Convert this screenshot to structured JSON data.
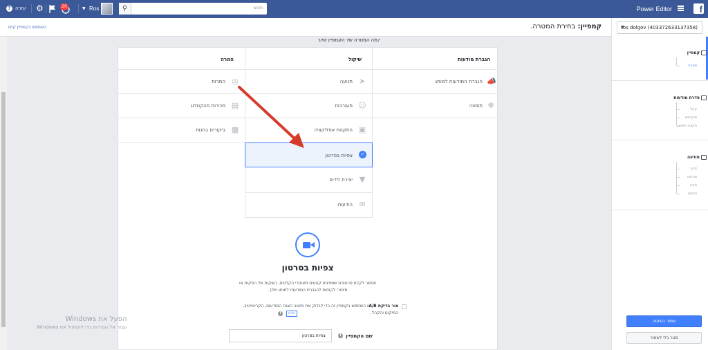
{
  "topbar": {
    "app_title": "Power Editor",
    "search_placeholder": "חפשו",
    "user_name": "Ros",
    "notification_count": "20",
    "help_label": "עזרה",
    "accent": "#3b5998"
  },
  "sidebar": {
    "account": "ros dolgov (403372633137358)",
    "sections": [
      {
        "title": "קמפיין",
        "icon": "folder-icon",
        "items": [
          "מטרה"
        ]
      },
      {
        "title": "סדרת מודעות",
        "icon": "grid-icon",
        "items": [
          "קהל",
          "מיקומים",
          "תקציב ותזמון"
        ]
      },
      {
        "title": "מודעה",
        "icon": "ad-icon",
        "items": [
          "זהות",
          "פורמט",
          "מדיה",
          "טקסט"
        ]
      }
    ],
    "save_button": "שמור בטיוטה",
    "close_button": "סגור בלי לשמור"
  },
  "header": {
    "title_bold": "קמפיין:",
    "title_rest": "בחירת המטרה.",
    "saved_link": "השתמש בקמפיין קיים",
    "cutoff_text": "מה המטרה של הקמפיין שלך?"
  },
  "objectives": {
    "columns": [
      "הגברת מודעות",
      "שיקול",
      "המרה"
    ],
    "awareness": [
      "הגברת המודעות למותג",
      "תפוצה"
    ],
    "consideration": [
      "תנועה",
      "מעורבות",
      "התקנות אפליקציה",
      "צפיות בסרטון",
      "יצירת לידים",
      "הודעות"
    ],
    "conversion": [
      "המרות",
      "מכירות מהקטלוג",
      "ביקורים בחנות"
    ]
  },
  "selected": {
    "title": "צפיות בסרטון",
    "description": "אפשר לקדם סרטונים שמציגים קטעים מאחורי הקלעים, השקות של הפקות או סיפורי לקוחות להגברת המודעות למותג שלך.",
    "ab_test_bold": "צור בדיקת A/B:",
    "ab_test_text": "השתמש בקמפיין זה כדי לבדוק את מיטוב הצגת המודעות, הקריאייטיב, המיקום והקהל.",
    "new_badge": "חדש",
    "name_label": "שם הקמפיין",
    "name_value": "צפיות בסרטון"
  },
  "watermark": {
    "line1": "הפעל את Windows",
    "line2": "עבור אל הגדרות כדי להפעיל את Windows"
  }
}
